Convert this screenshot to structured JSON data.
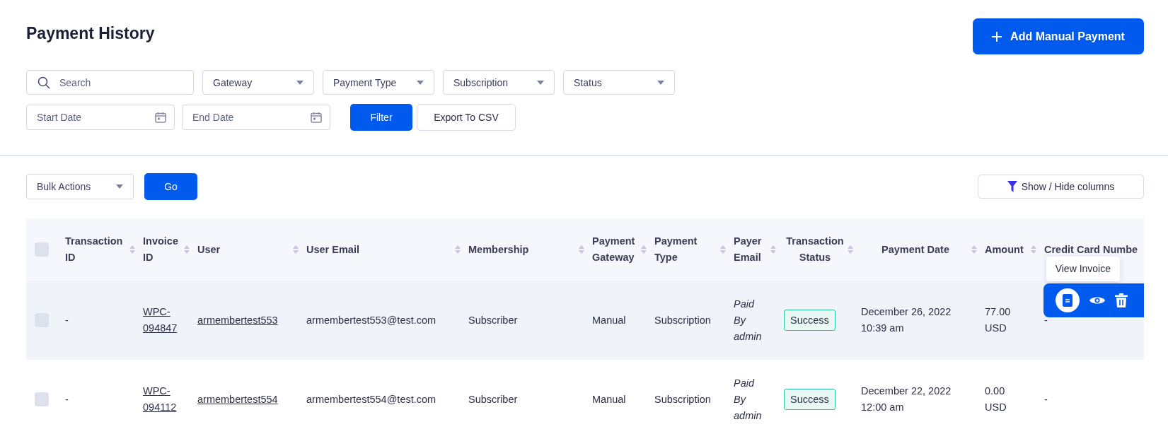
{
  "title": "Payment History",
  "add_button": {
    "label": "Add Manual Payment"
  },
  "filters": {
    "search": {
      "placeholder": "Search"
    },
    "dropdowns": [
      {
        "label": "Gateway"
      },
      {
        "label": "Payment Type"
      },
      {
        "label": "Subscription"
      },
      {
        "label": "Status"
      }
    ],
    "dates": [
      {
        "placeholder": "Start Date"
      },
      {
        "placeholder": "End Date"
      }
    ],
    "filter_button": "Filter",
    "export_button": "Export To CSV"
  },
  "bulk": {
    "select": "Bulk Actions",
    "go_button": "Go",
    "columns_button": "Show / Hide columns"
  },
  "table": {
    "select_all_checked": false,
    "columns": [
      {
        "label": "Transaction ID",
        "sortable": true,
        "kind": "text"
      },
      {
        "label": "Invoice ID",
        "sortable": true,
        "kind": "link"
      },
      {
        "label": "User",
        "sortable": true,
        "kind": "link"
      },
      {
        "label": "User Email",
        "sortable": true,
        "kind": "text"
      },
      {
        "label": "Membership",
        "sortable": true,
        "kind": "text"
      },
      {
        "label": "Payment Gateway",
        "sortable": true,
        "kind": "text"
      },
      {
        "label": "Payment Type",
        "sortable": true,
        "kind": "text"
      },
      {
        "label": "Payer Email",
        "sortable": true,
        "kind": "note"
      },
      {
        "label": "Transaction Status",
        "sortable": true,
        "kind": "badge"
      },
      {
        "label": "Payment Date",
        "sortable": true,
        "kind": "text"
      },
      {
        "label": "Amount",
        "sortable": true,
        "kind": "text"
      },
      {
        "label": "Credit Card Numbe",
        "sortable": false,
        "kind": "text"
      }
    ],
    "rows": [
      {
        "checked": false,
        "hovered": true,
        "cells": [
          "-",
          "WPC-094847",
          "armembertest553",
          "armembertest553@test.com",
          "Subscriber",
          "Manual",
          "Subscription",
          "Paid By admin",
          "Success",
          "December 26, 2022 10:39 am",
          "77.00 USD",
          "-"
        ],
        "actions": {
          "tooltip": "View Invoice",
          "items": [
            {
              "kind": "invoice",
              "selected": true
            },
            {
              "kind": "view",
              "selected": false
            },
            {
              "kind": "delete",
              "selected": false
            }
          ]
        }
      },
      {
        "checked": false,
        "hovered": false,
        "cells": [
          "-",
          "WPC-094112",
          "armembertest554",
          "armembertest554@test.com",
          "Subscriber",
          "Manual",
          "Subscription",
          "Paid By admin",
          "Success",
          "December 22, 2022 12:00 am",
          "0.00 USD",
          "-"
        ]
      }
    ]
  }
}
